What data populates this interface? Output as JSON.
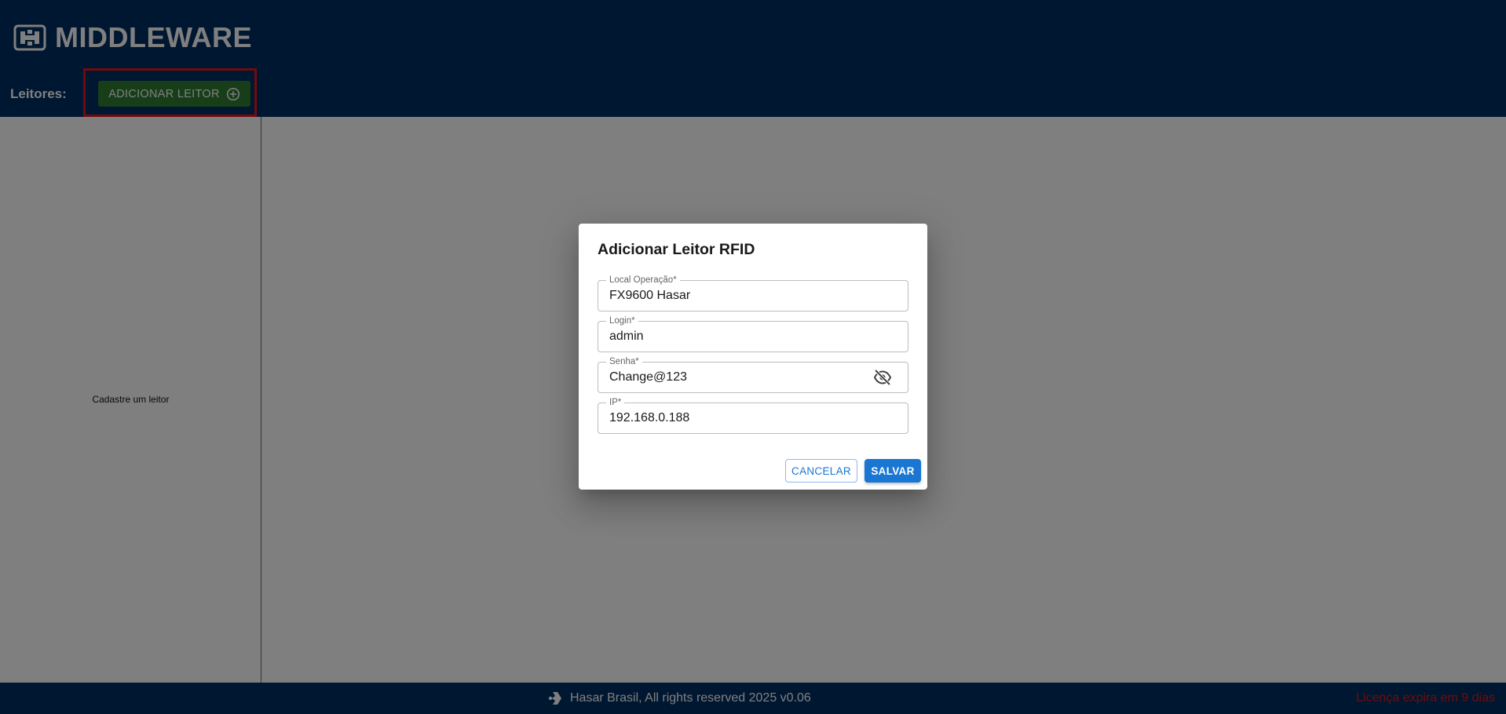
{
  "app": {
    "logo_text": "MIDDLEWARE",
    "logo_icon": "middleware-logo-icon"
  },
  "sidebar": {
    "readers_label": "Leitores:",
    "add_reader_label": "ADICIONAR LEITOR",
    "add_reader_icon": "plus-circle-icon",
    "empty_message": "Cadastre um leitor"
  },
  "footer": {
    "icon": "hasar-logo-icon",
    "copyright": "Hasar Brasil, All rights reserved 2025 v0.06",
    "license_notice": "Licença expira em 9 dias"
  },
  "dialog": {
    "title": "Adicionar Leitor RFID",
    "fields": [
      {
        "label": "Local Operação*",
        "value": "FX9600 Hasar"
      },
      {
        "label": "Login*",
        "value": "admin"
      },
      {
        "label": "Senha*",
        "value": "Change@123",
        "icon": "eye-off-icon"
      },
      {
        "label": "IP*",
        "value": "192.168.0.188"
      }
    ],
    "cancel_label": "CANCELAR",
    "save_label": "SALVAR"
  },
  "colors": {
    "header_bg": "#002f63",
    "add_button_bg": "#2e7d32",
    "highlight_border": "#e8141b",
    "primary": "#1976d2",
    "license_text": "#e3180f"
  }
}
